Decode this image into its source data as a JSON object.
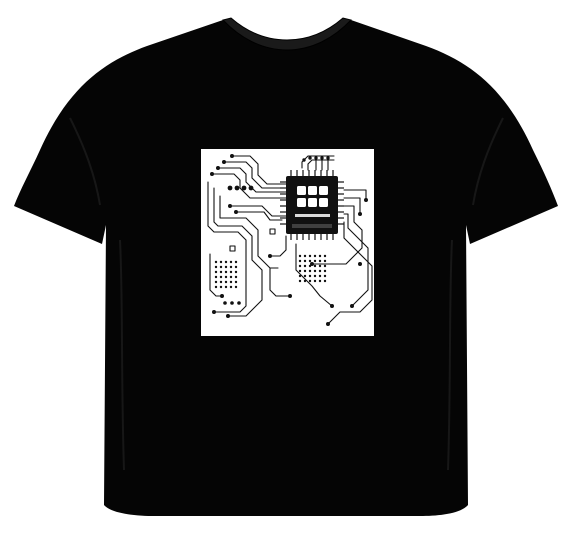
{
  "product": {
    "kind": "t-shirt",
    "shirt_color": "#050505",
    "background_color": "#ffffff",
    "print": {
      "motif": "circuit-board",
      "panel_color": "#ffffff",
      "ink_color": "#111111"
    }
  }
}
